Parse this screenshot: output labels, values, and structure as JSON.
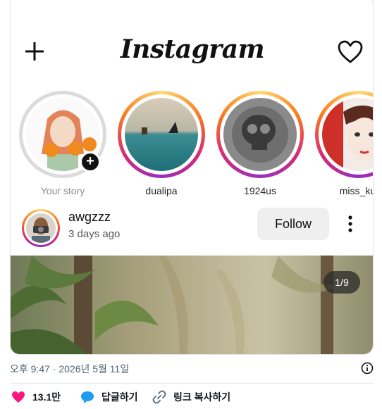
{
  "app": {
    "logo_text": "Instagram",
    "accent_gradient": [
      "#feda75",
      "#fa7e1e",
      "#d62976",
      "#962fbf"
    ]
  },
  "topbar": {
    "left_icon": "plus-icon",
    "right_icon": "heart-icon"
  },
  "stories": [
    {
      "label": "Your story",
      "own": true
    },
    {
      "label": "dualipa"
    },
    {
      "label": "1924us"
    },
    {
      "label": "miss_kul"
    }
  ],
  "post": {
    "username": "awgzzz",
    "time": "3 days ago",
    "follow_label": "Follow",
    "image_counter": "1/9"
  },
  "tweet_meta": {
    "timestamp": "오후 9:47 · 2026년 5월 11일"
  },
  "tweet_actions": {
    "likes": "13.1만",
    "reply_label": "답글하기",
    "copy_link_label": "링크 복사하기",
    "like_color": "#f91880",
    "reply_color": "#1d9bf0"
  }
}
